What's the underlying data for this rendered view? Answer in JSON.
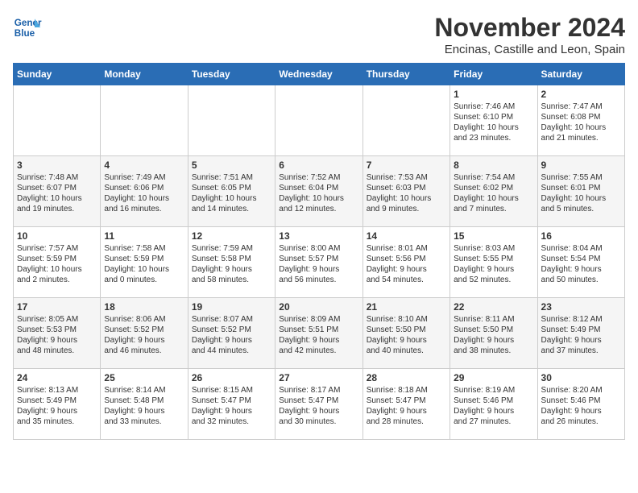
{
  "logo": {
    "line1": "General",
    "line2": "Blue"
  },
  "title": "November 2024",
  "subtitle": "Encinas, Castille and Leon, Spain",
  "headers": [
    "Sunday",
    "Monday",
    "Tuesday",
    "Wednesday",
    "Thursday",
    "Friday",
    "Saturday"
  ],
  "weeks": [
    [
      {
        "day": "",
        "text": ""
      },
      {
        "day": "",
        "text": ""
      },
      {
        "day": "",
        "text": ""
      },
      {
        "day": "",
        "text": ""
      },
      {
        "day": "",
        "text": ""
      },
      {
        "day": "1",
        "text": "Sunrise: 7:46 AM\nSunset: 6:10 PM\nDaylight: 10 hours\nand 23 minutes."
      },
      {
        "day": "2",
        "text": "Sunrise: 7:47 AM\nSunset: 6:08 PM\nDaylight: 10 hours\nand 21 minutes."
      }
    ],
    [
      {
        "day": "3",
        "text": "Sunrise: 7:48 AM\nSunset: 6:07 PM\nDaylight: 10 hours\nand 19 minutes."
      },
      {
        "day": "4",
        "text": "Sunrise: 7:49 AM\nSunset: 6:06 PM\nDaylight: 10 hours\nand 16 minutes."
      },
      {
        "day": "5",
        "text": "Sunrise: 7:51 AM\nSunset: 6:05 PM\nDaylight: 10 hours\nand 14 minutes."
      },
      {
        "day": "6",
        "text": "Sunrise: 7:52 AM\nSunset: 6:04 PM\nDaylight: 10 hours\nand 12 minutes."
      },
      {
        "day": "7",
        "text": "Sunrise: 7:53 AM\nSunset: 6:03 PM\nDaylight: 10 hours\nand 9 minutes."
      },
      {
        "day": "8",
        "text": "Sunrise: 7:54 AM\nSunset: 6:02 PM\nDaylight: 10 hours\nand 7 minutes."
      },
      {
        "day": "9",
        "text": "Sunrise: 7:55 AM\nSunset: 6:01 PM\nDaylight: 10 hours\nand 5 minutes."
      }
    ],
    [
      {
        "day": "10",
        "text": "Sunrise: 7:57 AM\nSunset: 5:59 PM\nDaylight: 10 hours\nand 2 minutes."
      },
      {
        "day": "11",
        "text": "Sunrise: 7:58 AM\nSunset: 5:59 PM\nDaylight: 10 hours\nand 0 minutes."
      },
      {
        "day": "12",
        "text": "Sunrise: 7:59 AM\nSunset: 5:58 PM\nDaylight: 9 hours\nand 58 minutes."
      },
      {
        "day": "13",
        "text": "Sunrise: 8:00 AM\nSunset: 5:57 PM\nDaylight: 9 hours\nand 56 minutes."
      },
      {
        "day": "14",
        "text": "Sunrise: 8:01 AM\nSunset: 5:56 PM\nDaylight: 9 hours\nand 54 minutes."
      },
      {
        "day": "15",
        "text": "Sunrise: 8:03 AM\nSunset: 5:55 PM\nDaylight: 9 hours\nand 52 minutes."
      },
      {
        "day": "16",
        "text": "Sunrise: 8:04 AM\nSunset: 5:54 PM\nDaylight: 9 hours\nand 50 minutes."
      }
    ],
    [
      {
        "day": "17",
        "text": "Sunrise: 8:05 AM\nSunset: 5:53 PM\nDaylight: 9 hours\nand 48 minutes."
      },
      {
        "day": "18",
        "text": "Sunrise: 8:06 AM\nSunset: 5:52 PM\nDaylight: 9 hours\nand 46 minutes."
      },
      {
        "day": "19",
        "text": "Sunrise: 8:07 AM\nSunset: 5:52 PM\nDaylight: 9 hours\nand 44 minutes."
      },
      {
        "day": "20",
        "text": "Sunrise: 8:09 AM\nSunset: 5:51 PM\nDaylight: 9 hours\nand 42 minutes."
      },
      {
        "day": "21",
        "text": "Sunrise: 8:10 AM\nSunset: 5:50 PM\nDaylight: 9 hours\nand 40 minutes."
      },
      {
        "day": "22",
        "text": "Sunrise: 8:11 AM\nSunset: 5:50 PM\nDaylight: 9 hours\nand 38 minutes."
      },
      {
        "day": "23",
        "text": "Sunrise: 8:12 AM\nSunset: 5:49 PM\nDaylight: 9 hours\nand 37 minutes."
      }
    ],
    [
      {
        "day": "24",
        "text": "Sunrise: 8:13 AM\nSunset: 5:49 PM\nDaylight: 9 hours\nand 35 minutes."
      },
      {
        "day": "25",
        "text": "Sunrise: 8:14 AM\nSunset: 5:48 PM\nDaylight: 9 hours\nand 33 minutes."
      },
      {
        "day": "26",
        "text": "Sunrise: 8:15 AM\nSunset: 5:47 PM\nDaylight: 9 hours\nand 32 minutes."
      },
      {
        "day": "27",
        "text": "Sunrise: 8:17 AM\nSunset: 5:47 PM\nDaylight: 9 hours\nand 30 minutes."
      },
      {
        "day": "28",
        "text": "Sunrise: 8:18 AM\nSunset: 5:47 PM\nDaylight: 9 hours\nand 28 minutes."
      },
      {
        "day": "29",
        "text": "Sunrise: 8:19 AM\nSunset: 5:46 PM\nDaylight: 9 hours\nand 27 minutes."
      },
      {
        "day": "30",
        "text": "Sunrise: 8:20 AM\nSunset: 5:46 PM\nDaylight: 9 hours\nand 26 minutes."
      }
    ]
  ]
}
